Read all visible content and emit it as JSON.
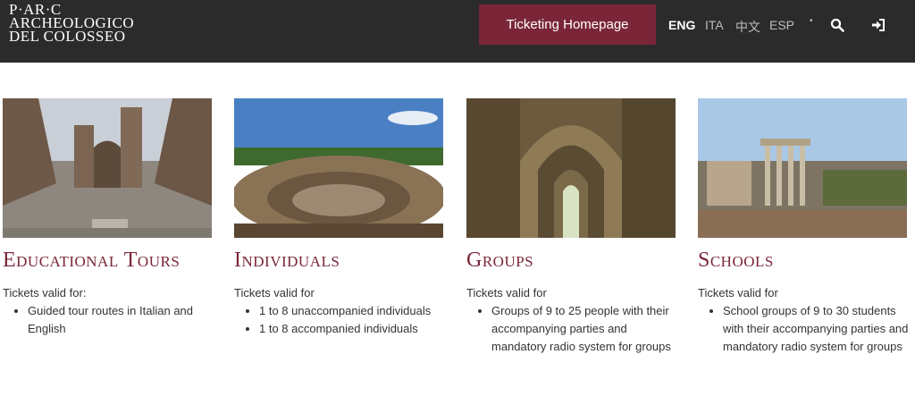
{
  "header": {
    "logo_lines": [
      "P·AR·C",
      "ARCHEOLOGICO",
      "DEL COLOSSEO"
    ],
    "ticket_button": "Ticketing Homepage",
    "languages": [
      "ENG",
      "ITA",
      "中文",
      "ESP"
    ],
    "active_language": "ENG",
    "dot": "•"
  },
  "cards": [
    {
      "title": "Educational Tours",
      "intro": "Tickets valid for:",
      "items": [
        "Guided tour routes in Italian and English"
      ]
    },
    {
      "title": "Individuals",
      "intro": "Tickets valid for",
      "items": [
        "1 to 8 unaccompanied individuals",
        "1 to 8 accompanied individuals"
      ]
    },
    {
      "title": "Groups",
      "intro": "Tickets valid for",
      "items": [
        "Groups of 9 to 25 people with their accompanying parties and mandatory radio system for groups"
      ]
    },
    {
      "title": "Schools",
      "intro": "Tickets valid for",
      "items": [
        "School groups of 9 to 30 students with their accompanying parties and mandatory radio system for groups"
      ]
    }
  ],
  "colors": {
    "header_bg": "#2b2b2b",
    "accent": "#7a2638"
  },
  "icons": [
    "search-icon",
    "login-icon"
  ]
}
